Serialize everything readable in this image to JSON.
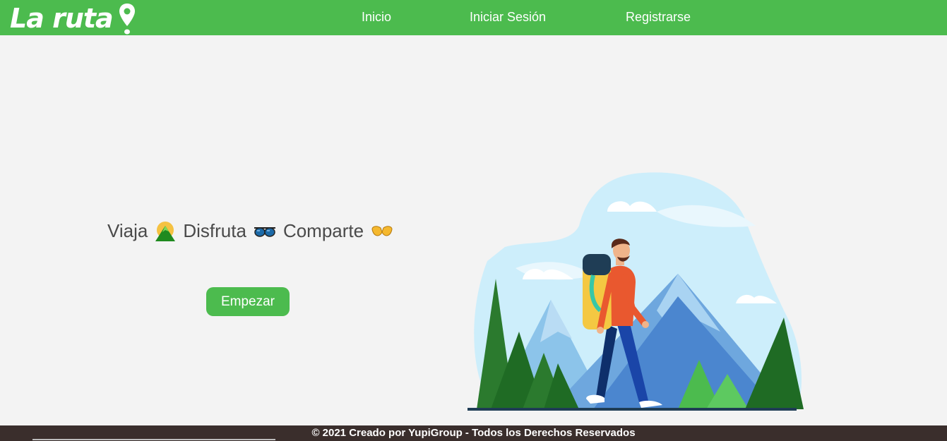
{
  "navbar": {
    "brand": "La ruta",
    "links": [
      "Inicio",
      "Iniciar Sesión",
      "Registrarse"
    ]
  },
  "hero": {
    "words": [
      "Viaja",
      "Disfruta",
      "Comparte"
    ],
    "icons": [
      "mountain-icon",
      "sunglasses-icon",
      "hands-icon"
    ],
    "button_label": "Empezar"
  },
  "illustration": {
    "name": "hiker-mountains-illustration"
  },
  "footer": {
    "text": "© 2021 Creado por YupiGroup - Todos los Derechos Reservados"
  },
  "colors": {
    "primary": "#4cbb4e",
    "footer": "#3a2e2c",
    "background": "#f3f3f3",
    "text": "#4a4a4a"
  }
}
